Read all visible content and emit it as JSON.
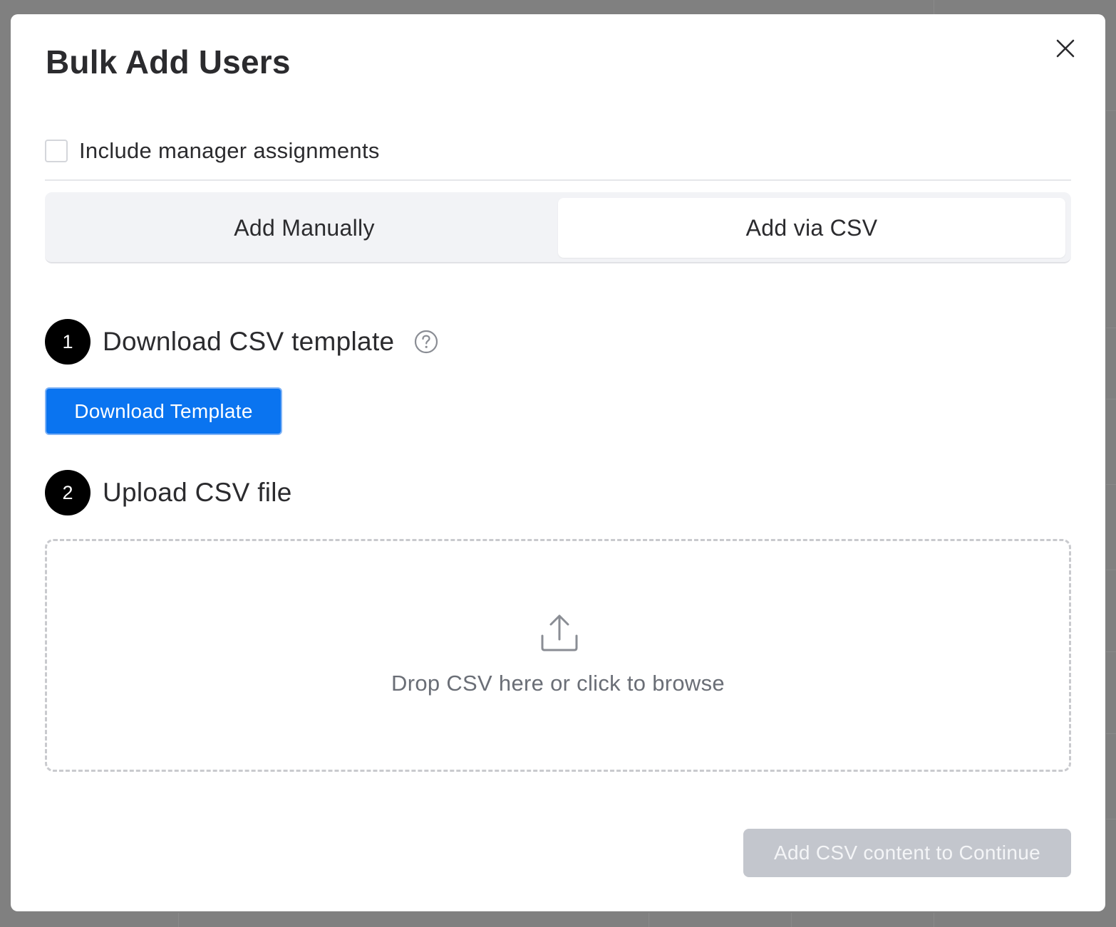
{
  "modal": {
    "title": "Bulk Add Users"
  },
  "options": {
    "include_manager_label": "Include manager assignments",
    "include_manager_checked": false
  },
  "tabs": [
    {
      "label": "Add Manually",
      "active": false
    },
    {
      "label": "Add via CSV",
      "active": true
    }
  ],
  "steps": [
    {
      "number": "1",
      "title": "Download CSV template"
    },
    {
      "number": "2",
      "title": "Upload CSV file"
    }
  ],
  "download_button": {
    "label": "Download Template"
  },
  "dropzone": {
    "text": "Drop CSV here or click to browse",
    "icon": "upload-icon"
  },
  "footer": {
    "continue_label": "Add CSV content to Continue",
    "continue_disabled": true
  },
  "icons": {
    "close": "close-icon",
    "help": "help-circle-icon",
    "upload": "upload-icon"
  },
  "colors": {
    "primary": "#0a74f0",
    "disabled": "#c3c6cd",
    "step_badge": "#000000"
  }
}
